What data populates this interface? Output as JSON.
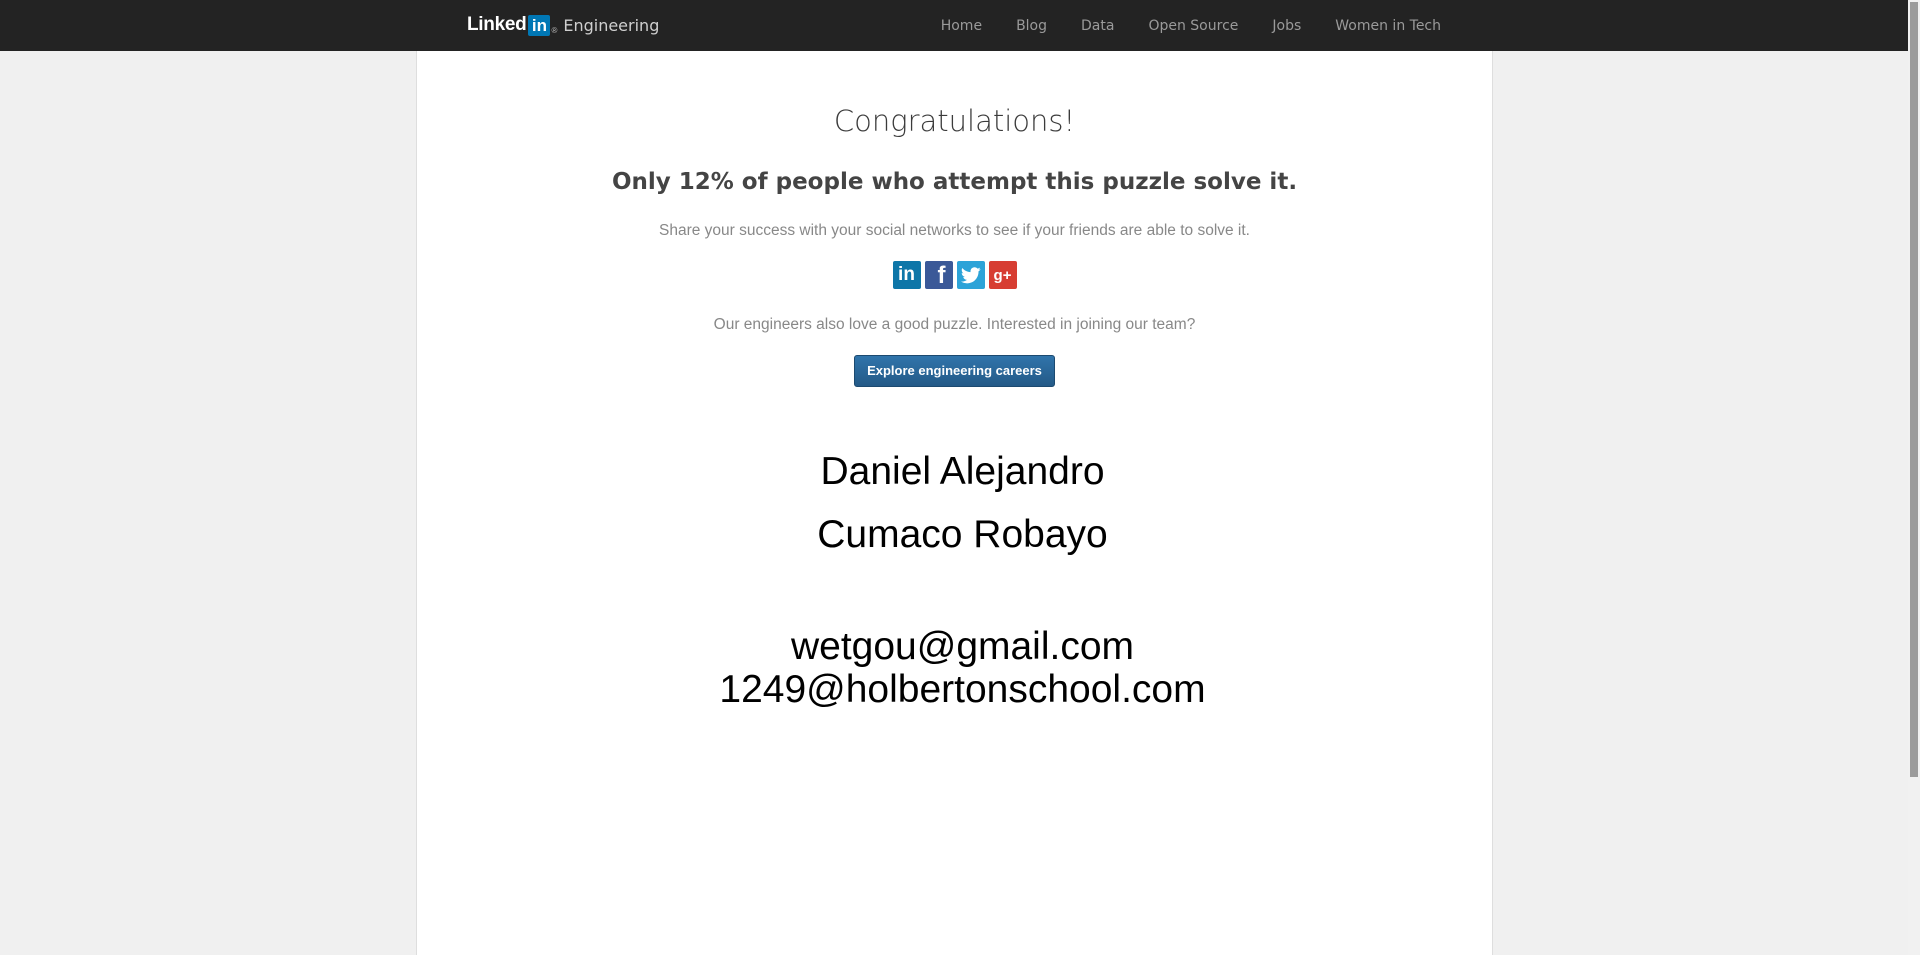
{
  "navbar": {
    "brand_linked": "Linked",
    "brand_in": "in",
    "brand_reg": "®",
    "brand_section": "Engineering",
    "links": [
      "Home",
      "Blog",
      "Data",
      "Open Source",
      "Jobs",
      "Women in Tech"
    ]
  },
  "main": {
    "heading": "Congratulations!",
    "stat": "Only 12% of people who attempt this puzzle solve it.",
    "share_text": "Share your success with your social networks to see if your friends are able to solve it.",
    "social": {
      "linkedin": "in",
      "facebook": "f",
      "twitter": "twitter",
      "googleplus": "g+"
    },
    "join_text": "Our engineers also love a good puzzle. Interested in joining our team?",
    "careers_button": "Explore engineering careers",
    "name_line1": "Daniel Alejandro",
    "name_line2": "Cumaco Robayo",
    "email1": "wetgou@gmail.com",
    "email2": "1249@holbertonschool.com"
  },
  "colors": {
    "navbar_bg": "#232323",
    "page_bg": "#f0f0f0",
    "button_bg": "#2a6496",
    "linkedin_blue": "#0077b5",
    "facebook_blue": "#3b5998",
    "twitter_blue": "#2ca3d8",
    "googleplus_red": "#d73d32"
  }
}
